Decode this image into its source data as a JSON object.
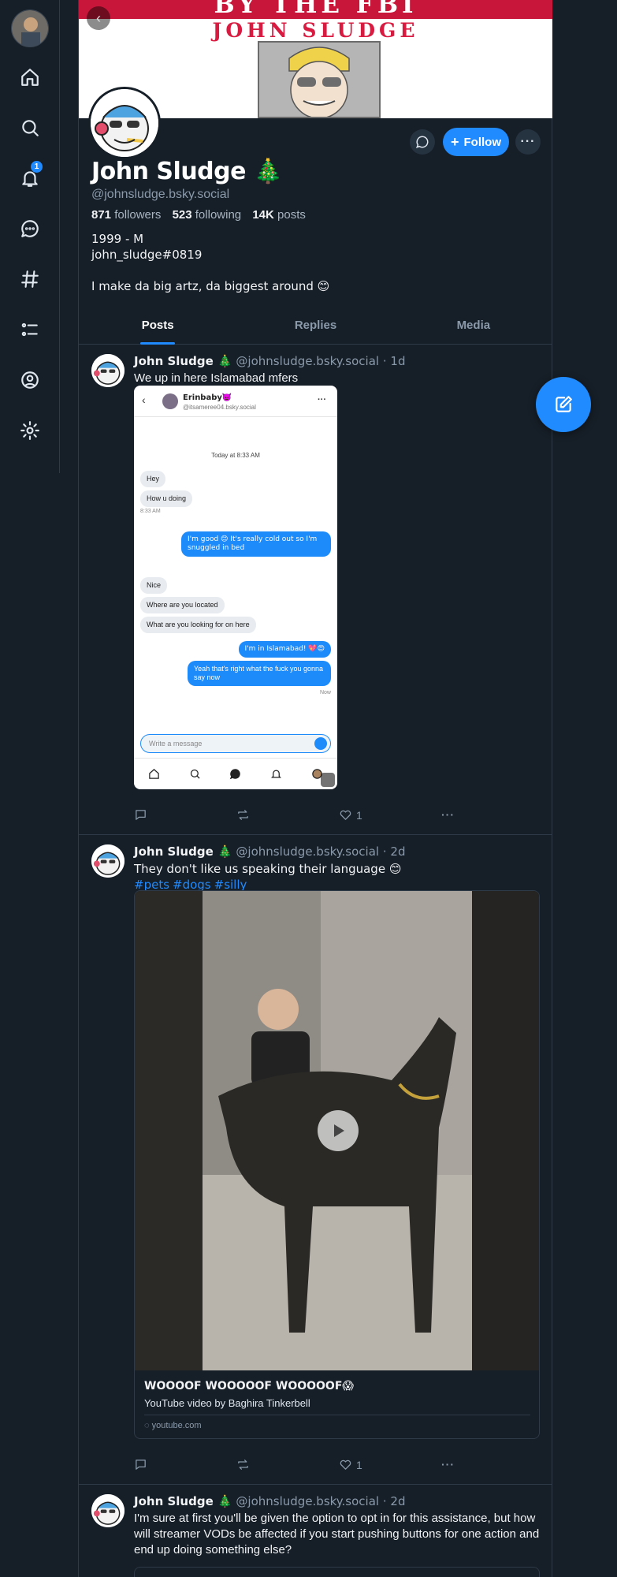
{
  "rail": {
    "badge_count": "1"
  },
  "banner": {
    "top_text": "BY THE FBI",
    "name_text": "JOHN SLUDGE"
  },
  "profile": {
    "display_name": "John Sludge 🎄",
    "handle": "@johnsludge.bsky.social",
    "followers_count": "871",
    "followers_label": "followers",
    "following_count": "523",
    "following_label": "following",
    "posts_count": "14K",
    "posts_label": "posts",
    "bio_line1": "1999 - M",
    "bio_line2": "john_sludge#0819",
    "bio_line3": "I make da big artz, da biggest around 😊",
    "follow_label": "Follow"
  },
  "tabs": [
    "Posts",
    "Replies",
    "Media"
  ],
  "posts": [
    {
      "author": "John Sludge 🎄",
      "handle": "@johnsludge.bsky.social",
      "time": "· 1d",
      "text": "We up in here Islamabad mfers",
      "likes": "1",
      "embed": {
        "contact_name": "Erinbaby👿",
        "contact_handle": "@itsameree04.bsky.social",
        "today": "Today at 8:33 AM",
        "messages": [
          {
            "dir": "in",
            "text": "Hey"
          },
          {
            "dir": "in",
            "text": "How u doing"
          },
          {
            "dir": "out",
            "text": "I'm good 😊 It's really cold out so I'm snuggled in bed"
          },
          {
            "dir": "in",
            "text": "Nice"
          },
          {
            "dir": "in",
            "text": "Where are you located"
          },
          {
            "dir": "in",
            "text": "What are you looking for on here"
          },
          {
            "dir": "out",
            "text": "I'm in Islamabad! 💖😍"
          },
          {
            "dir": "out",
            "text": "Yeah that's right what the fuck you gonna say now"
          }
        ],
        "stamp1": "8:33 AM",
        "stamp2": "Now",
        "composer_placeholder": "Write a message"
      }
    },
    {
      "author": "John Sludge 🎄",
      "handle": "@johnsludge.bsky.social",
      "time": "· 2d",
      "text": "They don't like us speaking their language 😊",
      "tags": [
        "#pets",
        "#dogs",
        "#silly"
      ],
      "likes": "1",
      "card": {
        "title": "WOOOOF WOOOOOF WOOOOOF😱",
        "description": "YouTube video by Baghira Tinkerbell",
        "domain": "youtube.com"
      }
    },
    {
      "author": "John Sludge 🎄",
      "handle": "@johnsludge.bsky.social",
      "time": "· 2d",
      "text": "I'm sure at first you'll be given the option to opt in for this assistance, but how will streamer VODs be affected if you start pushing buttons for one action and end up doing something else?"
    }
  ]
}
